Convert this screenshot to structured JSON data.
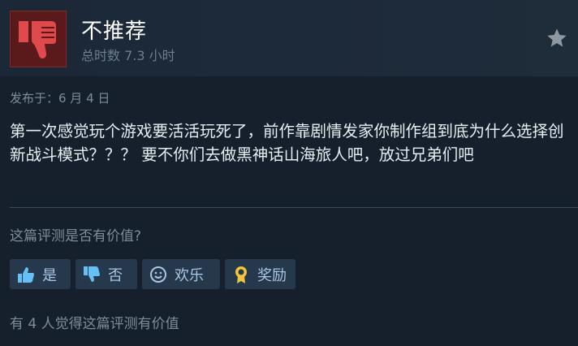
{
  "review": {
    "verdict": "不推荐",
    "hours": "总时数 7.3 小时",
    "posted": "发布于：6 月 4 日",
    "body": "第一次感觉玩个游戏要活活玩死了，前作靠剧情发家你制作组到底为什么选择创新战斗模式？？？ 要不你们去做黑神话山海旅人吧，放过兄弟们吧"
  },
  "feedback": {
    "question": "这篇评测是否有价值?",
    "buttons": {
      "yes": "是",
      "no": "否",
      "funny": "欢乐",
      "award": "奖励"
    },
    "helpful_count_text": "有 4 人觉得这篇评测有价值"
  },
  "colors": {
    "background": "#16202d",
    "thumb_down_red": "#e04a4c",
    "button_bg": "#26384c",
    "button_text": "#a9c7e3",
    "muted_text": "#7d8c99"
  },
  "icons": {
    "verdict": "thumbs-down-icon",
    "favorite": "star-icon",
    "yes": "thumbs-up-icon",
    "no": "thumbs-down-icon",
    "funny": "smiley-icon",
    "award": "award-medal-icon"
  }
}
